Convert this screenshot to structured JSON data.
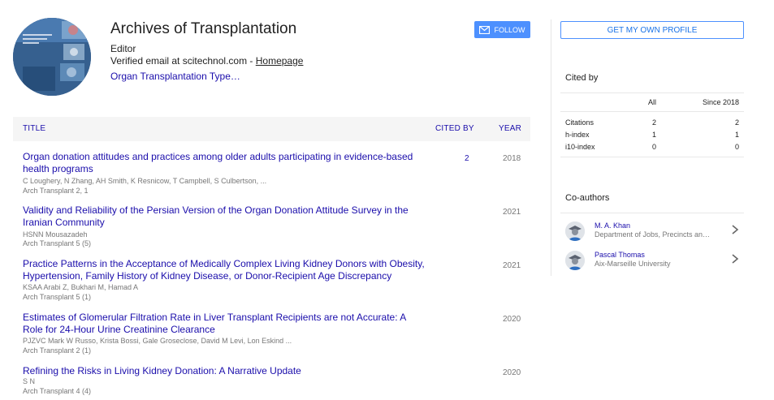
{
  "profile": {
    "name": "Archives of Transplantation",
    "role": "Editor",
    "email_text": "Verified email at scitechnol.com - ",
    "homepage_label": "Homepage",
    "interests": "Organ Transplantation Type…",
    "avatar_icon": "journal-cover-image",
    "follow_label": "FOLLOW",
    "follow_icon": "mail-icon"
  },
  "table": {
    "headers": {
      "title": "TITLE",
      "cited_by": "CITED BY",
      "year": "YEAR"
    },
    "rows": [
      {
        "title": "Organ donation attitudes and practices among older adults participating in evidence-based health programs",
        "authors": "C Loughery, N Zhang, AH Smith, K Resnicow, T Campbell, S Culbertson, ...",
        "publication": "Arch Transplant 2, 1",
        "cited_by": "2",
        "year": "2018"
      },
      {
        "title": "Validity and Reliability of the Persian Version of the Organ Donation Attitude Survey in the Iranian Community",
        "authors": "HSNN Mousazadeh",
        "publication": "Arch Transplant 5 (5)",
        "cited_by": "",
        "year": "2021"
      },
      {
        "title": "Practice Patterns in the Acceptance of Medically Complex Living Kidney Donors with Obesity, Hypertension, Family History of Kidney Disease, or Donor-Recipient Age Discrepancy",
        "authors": "KSAA Arabi Z, Bukhari M, Hamad A",
        "publication": "Arch Transplant 5 (1)",
        "cited_by": "",
        "year": "2021"
      },
      {
        "title": "Estimates of Glomerular Filtration Rate in Liver Transplant Recipients are not Accurate: A Role for 24-Hour Urine Creatinine Clearance",
        "authors": "PJZVC Mark W Russo, Krista Bossi, Gale Groseclose, David M Levi, Lon Eskind ...",
        "publication": "Arch Transplant 2 (1)",
        "cited_by": "",
        "year": "2020"
      },
      {
        "title": "Refining the Risks in Living Kidney Donation: A Narrative Update",
        "authors": "S N",
        "publication": "Arch Transplant 4 (4)",
        "cited_by": "",
        "year": "2020"
      }
    ]
  },
  "sidebar": {
    "get_profile_label": "GET MY OWN PROFILE",
    "cited_by_title": "Cited by",
    "cited_headers": {
      "all": "All",
      "since": "Since 2018"
    },
    "cited_rows": [
      {
        "label": "Citations",
        "all": "2",
        "since": "2"
      },
      {
        "label": "h-index",
        "all": "1",
        "since": "1"
      },
      {
        "label": "i10-index",
        "all": "0",
        "since": "0"
      }
    ],
    "coauthors_title": "Co-authors",
    "coauthors": [
      {
        "name": "M. A. Khan",
        "affiliation": "Department of Jobs, Precincts an…",
        "icon": "person-avatar-icon"
      },
      {
        "name": "Pascal Thomas",
        "affiliation": "Aix-Marseille University",
        "icon": "person-avatar-icon"
      }
    ]
  },
  "colors": {
    "link": "#1a0dab",
    "accent": "#4d90fe",
    "muted": "#777777",
    "header_bg": "#f5f5f5"
  }
}
